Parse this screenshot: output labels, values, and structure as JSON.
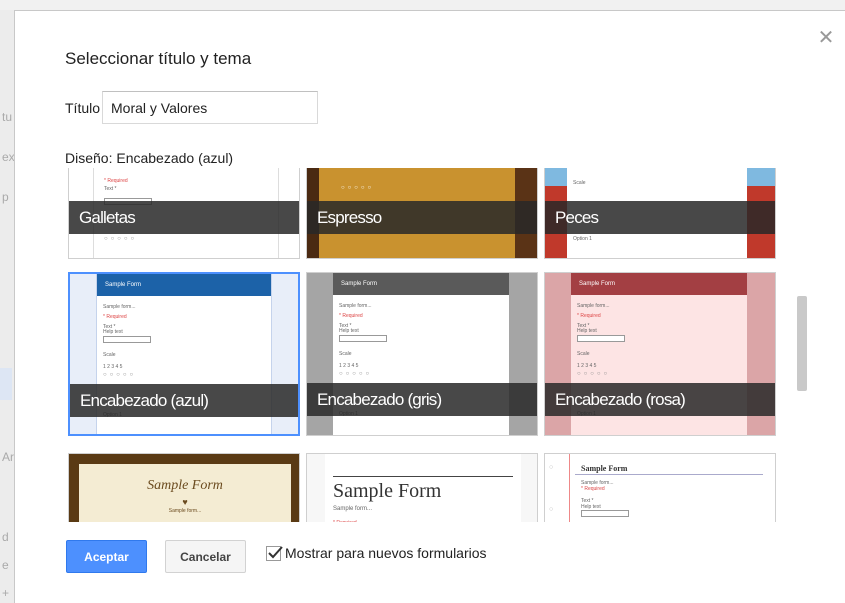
{
  "dialog": {
    "title": "Seleccionar título y tema",
    "close_icon": "close-icon",
    "title_label": "Título",
    "title_value": "Moral y Valores",
    "design_label": "Diseño: Encabezado (azul)"
  },
  "themes": [
    {
      "label": "Galletas",
      "selected": false
    },
    {
      "label": "Espresso",
      "selected": false
    },
    {
      "label": "Peces",
      "selected": false
    },
    {
      "label": "Encabezado (azul)",
      "selected": true
    },
    {
      "label": "Encabezado (gris)",
      "selected": false
    },
    {
      "label": "Encabezado (rosa)",
      "selected": false
    }
  ],
  "preview": {
    "header": "Sample Form",
    "desc": "Sample form...",
    "required": "* Required",
    "text_q": "Text *",
    "help": "Help text",
    "scale": "Scale",
    "numbers": "1  2  3  4  5",
    "option": "Option 1",
    "serif_title": "Sample Form",
    "serif_desc": "Sample form..."
  },
  "footer": {
    "accept_label": "Aceptar",
    "cancel_label": "Cancelar",
    "checkbox_label": "Mostrar para nuevos formularios",
    "checkbox_checked": true
  },
  "colors": {
    "accent": "#4d90fe",
    "blue_header": "#1c62a8",
    "gray_header": "#5a5a5a",
    "pink_header": "#a33f43"
  }
}
